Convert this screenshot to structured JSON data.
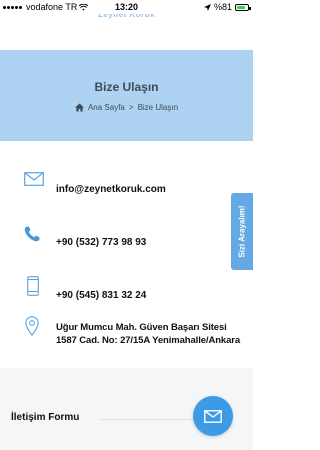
{
  "status_bar": {
    "carrier": "vodafone TR",
    "time": "13:20",
    "battery": "%81",
    "battery_level": 0.81
  },
  "header": {
    "logo_text": "Zeynet Koruk"
  },
  "hero": {
    "title": "Bize Ulaşın",
    "breadcrumb": {
      "home": "Ana Sayfa",
      "separator": ">",
      "current": "Bize Ulaşın"
    }
  },
  "contacts": {
    "email": "info@zeynetkoruk.com",
    "phone": "+90 (532) 773 98 93",
    "mobile": "+90 (545) 831 32 24",
    "address_line1": "Uğur Mumcu Mah. Güven Başarı Sitesi",
    "address_line2": "1587 Cad. No: 27/15A Yenimahalle/Ankara"
  },
  "side_tab": {
    "label": "Sizi Arayalım!"
  },
  "form": {
    "title": "İletişim Formu"
  },
  "colors": {
    "hero_bg": "#aed3f2",
    "accent": "#64a9e3",
    "fab": "#3d9be5"
  }
}
